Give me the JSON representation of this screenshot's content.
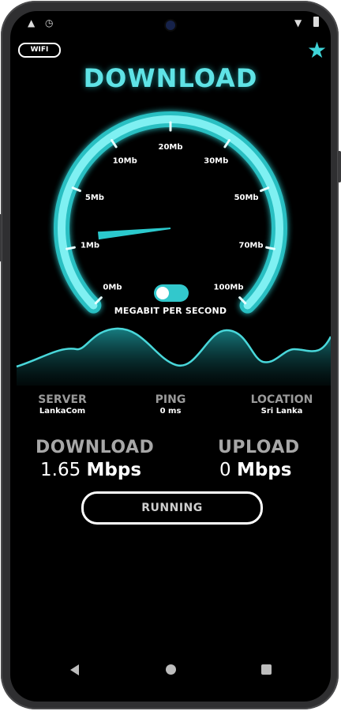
{
  "status_bar": {
    "left_icons": [
      "notification-icon",
      "clock-icon"
    ],
    "right_icons": [
      "signal-icon",
      "battery-icon"
    ]
  },
  "header": {
    "connection_badge": "WIFI",
    "title": "DOWNLOAD",
    "favorite_icon": "star-icon"
  },
  "gauge": {
    "scale_labels": [
      "0Mb",
      "1Mb",
      "5Mb",
      "10Mb",
      "20Mb",
      "30Mb",
      "50Mb",
      "70Mb",
      "100Mb"
    ],
    "current_value_mbps": 1.65,
    "unit_toggle_on": true,
    "unit_label": "MEGABIT PER SECOND"
  },
  "info": {
    "server_label": "SERVER",
    "server_value": "LankaCom",
    "ping_label": "PING",
    "ping_value": "0 ms",
    "location_label": "LOCATION",
    "location_value": "Sri Lanka"
  },
  "results": {
    "download_label": "DOWNLOAD",
    "download_number": "1.65",
    "download_unit": "Mbps",
    "upload_label": "UPLOAD",
    "upload_number": "0",
    "upload_unit": "Mbps"
  },
  "action": {
    "status_button_label": "RUNNING"
  },
  "nav_bar": {
    "icons": [
      "back-icon",
      "home-icon",
      "recents-icon"
    ]
  },
  "colors": {
    "accent": "#2dd4d8",
    "background": "#000000",
    "frame": "#2f2f31"
  }
}
